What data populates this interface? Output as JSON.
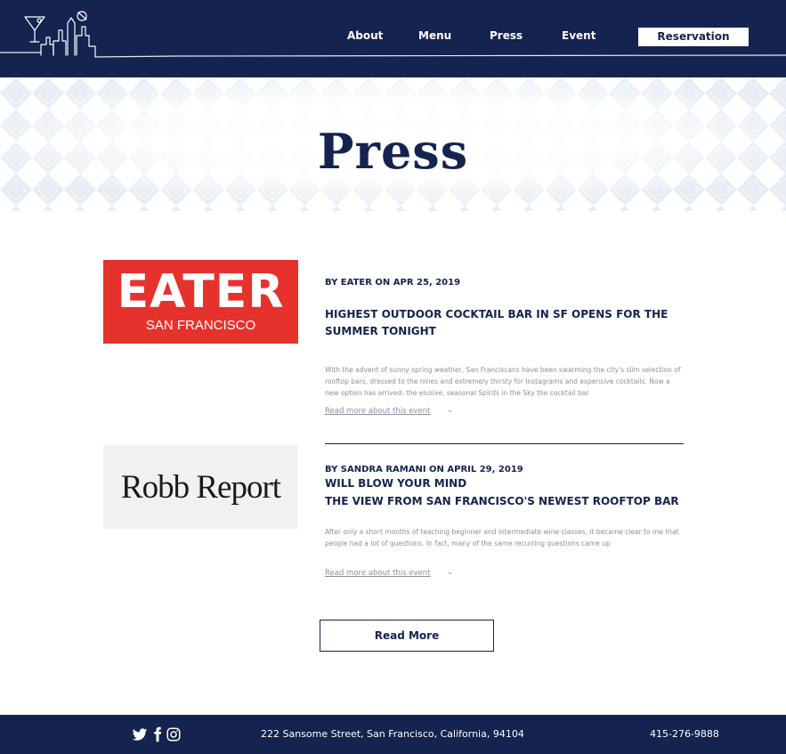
{
  "nav": {
    "items": [
      "About",
      "Menu",
      "Press",
      "Event"
    ],
    "reservation_label": "Reservation"
  },
  "banner": {
    "title": "Press"
  },
  "articles": [
    {
      "logo_name": "EATER",
      "logo_sub": "SAN FRANCISCO",
      "byline": "BY EATER ON APR 25, 2019",
      "headline": "HIGHEST OUTDOOR COCKTAIL BAR IN SF OPENS FOR THE SUMMER TONIGHT",
      "excerpt": "With the advent of sunny spring weather, San Franciscans have been swarming the city's slim selection of rooftop bars, dressed to the nines and extremely thirsty for Instagrams and expensive cocktails. Now a new option has arrived: the elusive, seasonal Spirits in the Sky the cocktail bar",
      "read_more": "Read more about this event"
    },
    {
      "logo_name": "Robb Report",
      "byline": "BY SANDRA RAMANI ON APRIL 29, 2019",
      "headline": "WILL BLOW YOUR MIND\nTHE VIEW FROM SAN FRANCISCO'S NEWEST ROOFTOP BAR",
      "excerpt": "After only a short months of teaching beginner and intermediate wine classes, it became clear to me that people had a lot of questions. In fact, many of the same recurring questions came up",
      "read_more": "Read more about this event"
    }
  ],
  "read_more_button": "Read More",
  "footer": {
    "social": [
      "twitter-icon",
      "facebook-icon",
      "instagram-icon"
    ],
    "address": "222 Sansome Street, San Francisco, California, 94104",
    "phone": "415-276-9888"
  },
  "colors": {
    "navy": "#14234f",
    "eater_red": "#e5322d",
    "robb_bg": "#f1f1f1",
    "pattern": "#e6edf5"
  }
}
